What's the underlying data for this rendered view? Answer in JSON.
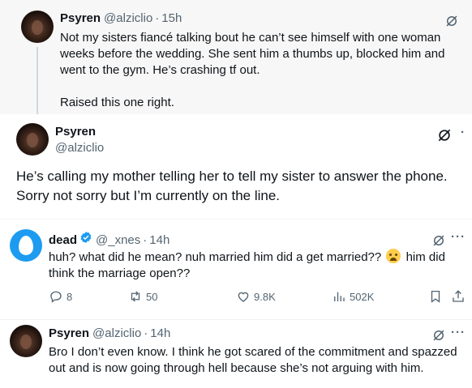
{
  "parent_tweet": {
    "display_name": "Psyren",
    "handle": "@alziclio",
    "time": "15h",
    "text_lines": [
      "Not my sisters fiancé talking bout he can’t see himself with one woman",
      "weeks before the wedding. She sent him a thumbs up, blocked him and",
      "went to the gym. He’s crashing tf out."
    ],
    "text_tail": "Raised this one right."
  },
  "focal_tweet": {
    "display_name": "Psyren",
    "handle": "@alziclio",
    "text_lines": [
      "He’s calling my mother telling her to tell my sister to answer the phone.",
      "Sorry not sorry but I’m currently on the line."
    ]
  },
  "reply_1": {
    "display_name": "dead",
    "handle": "@_xnes",
    "time": "14h",
    "text_line1_before": "huh? what did he mean? nuh married him did a get married??",
    "text_line1_after": "him did",
    "text_line2": "think the marriage open??",
    "stats": {
      "replies": "8",
      "reposts": "50",
      "likes": "9.8K",
      "views": "502K"
    }
  },
  "reply_2": {
    "display_name": "Psyren",
    "handle": "@alziclio",
    "time": "14h",
    "text_lines": [
      "Bro I don’t even know. I think he got scared of the commitment and spazzed",
      "out and is now going through hell because she’s not arguing with him."
    ]
  },
  "ui": {
    "dot": "·",
    "more": "···",
    "icons": [
      "grok-icon",
      "more-icon",
      "reply-icon",
      "repost-icon",
      "like-icon",
      "views-icon",
      "bookmark-icon",
      "share-icon",
      "verified-badge-icon",
      "crying-face-emoji"
    ],
    "colors": {
      "text": "#0f1419",
      "secondary": "#536471",
      "verified": "#1d9bf0",
      "parent_bg": "#f7f7f7"
    }
  }
}
